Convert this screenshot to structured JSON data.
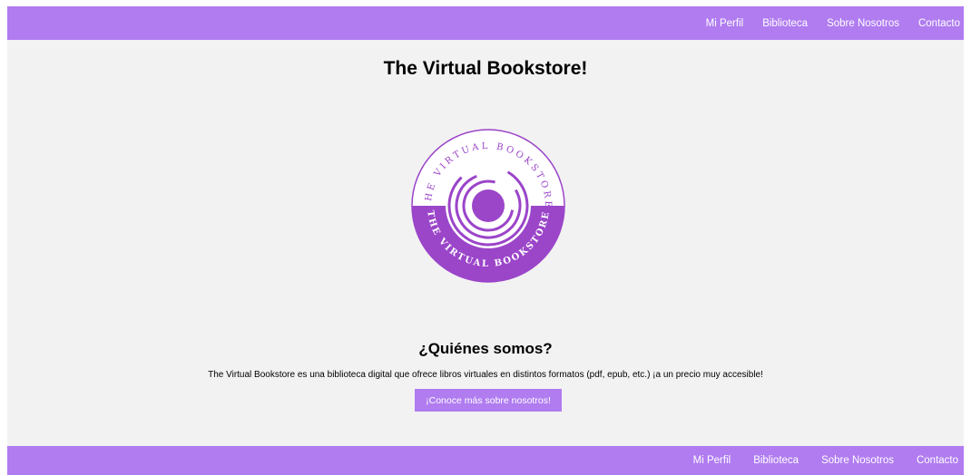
{
  "nav": {
    "items": [
      "Mi Perfil",
      "Biblioteca",
      "Sobre Nosotros",
      "Contacto"
    ]
  },
  "header": {
    "title": "The Virtual Bookstore!"
  },
  "logo": {
    "text": "THE VIRTUAL BOOKSTORE",
    "icon": "vinyl-disc-logo"
  },
  "about": {
    "title": "¿Quiénes somos?",
    "text": "The Virtual Bookstore es una biblioteca digital que ofrece libros virtuales en distintos formatos (pdf, epub, etc.) ¡a un precio muy accesible!",
    "button_label": "¡Conoce más sobre nosotros!"
  },
  "colors": {
    "accent": "#b07cf0",
    "logo_purple": "#9b45c9",
    "background": "#f2f2f2"
  }
}
